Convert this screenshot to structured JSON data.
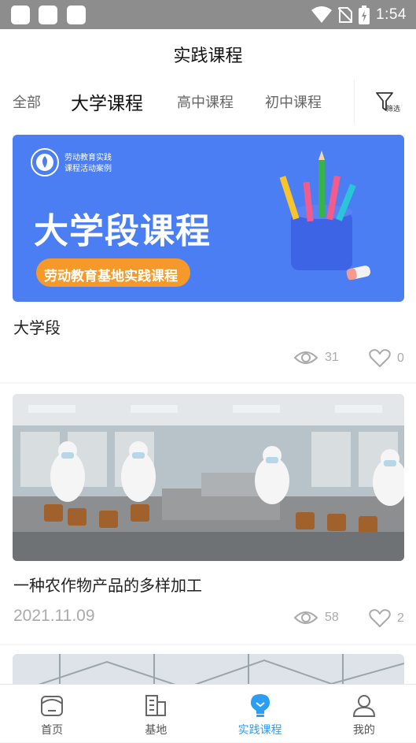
{
  "status_bar": {
    "time": "1:54"
  },
  "header": {
    "title": "实践课程"
  },
  "tabs": [
    {
      "label": "全部"
    },
    {
      "label": "大学课程"
    },
    {
      "label": "高中课程"
    },
    {
      "label": "初中课程"
    }
  ],
  "filter": {
    "label": "筛选"
  },
  "cards": [
    {
      "banner": {
        "logo_line1": "劳动教育实践",
        "logo_line2": "课程活动案例",
        "headline": "大学段课程",
        "pill": "劳动教育基地实践课程"
      },
      "title": "大学段",
      "date": "",
      "views": "31",
      "likes": "0"
    },
    {
      "title": "一种农作物产品的多样加工",
      "date": "2021.11.09",
      "views": "58",
      "likes": "2"
    }
  ],
  "bottom_nav": [
    {
      "label": "首页"
    },
    {
      "label": "基地"
    },
    {
      "label": "实践课程"
    },
    {
      "label": "我的"
    }
  ],
  "colors": {
    "accent": "#2a9ef3",
    "banner_blue": "#4a7ef2",
    "pill_orange": "#f59a2a"
  }
}
